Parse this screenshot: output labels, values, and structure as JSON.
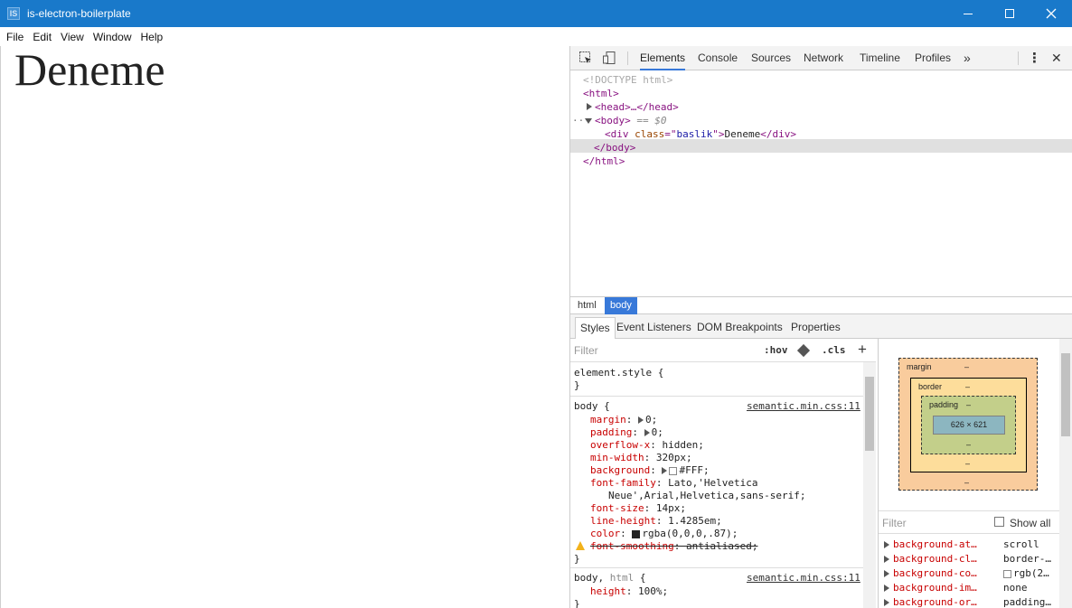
{
  "window": {
    "app_icon_text": "IS",
    "title": "is-electron-boilerplate",
    "minimize_label": "—",
    "close_label": "✕"
  },
  "menu": [
    "File",
    "Edit",
    "View",
    "Window",
    "Help"
  ],
  "page": {
    "heading": "Deneme"
  },
  "devtools": {
    "tabs": [
      "Elements",
      "Console",
      "Sources",
      "Network",
      "Timeline",
      "Profiles"
    ],
    "more_tabs": "»",
    "kebab": "⋮",
    "close": "✕",
    "dom": {
      "doctype": "<!DOCTYPE html>",
      "html_open": "<html>",
      "head": "<head>…</head>",
      "body_open": "<body>",
      "body_marker": " == $0",
      "div_open_tag": "<div",
      "div_attr_name": " class",
      "div_attr_eq": "=\"",
      "div_attr_value": "baslik",
      "div_attr_end": "\">",
      "div_text": "Deneme",
      "div_close": "</div>",
      "body_close": "</body>",
      "html_close": "</html>",
      "ellipsis_marker": "···"
    },
    "breadcrumbs": [
      "html",
      "body"
    ],
    "subtabs": [
      "Styles",
      "Event Listeners",
      "DOM Breakpoints",
      "Properties"
    ],
    "styles": {
      "filter_placeholder": "Filter",
      "hov": ":hov",
      "cls": ".cls",
      "add": "+",
      "element_style": "element.style {",
      "close_brace": "}",
      "rule1_selector": "body {",
      "rule1_source": "semantic.min.css:11",
      "rule1": [
        {
          "prop": "margin",
          "val": "0;"
        },
        {
          "prop": "padding",
          "val": "0;"
        },
        {
          "prop": "overflow-x",
          "val": "hidden;"
        },
        {
          "prop": "min-width",
          "val": "320px;"
        },
        {
          "prop": "background",
          "val": "#FFF;"
        },
        {
          "prop": "font-family",
          "val": "Lato,'Helvetica"
        },
        {
          "prop": "",
          "val": "Neue',Arial,Helvetica,sans-serif;"
        },
        {
          "prop": "font-size",
          "val": "14px;"
        },
        {
          "prop": "line-height",
          "val": "1.4285em;"
        },
        {
          "prop": "color",
          "val": "rgba(0,0,0,.87);"
        },
        {
          "prop": "font-smoothing",
          "val": "antialiased;"
        }
      ],
      "rule2_selector_a": "body, ",
      "rule2_selector_b": "html",
      "rule2_selector_c": " {",
      "rule2_source": "semantic.min.css:11",
      "rule2": [
        {
          "prop": "height",
          "val": "100%;"
        }
      ]
    },
    "box_model": {
      "margin_label": "margin",
      "border_label": "border",
      "padding_label": "padding",
      "dash": "–",
      "content_size": "626 × 621"
    },
    "computed": {
      "filter_placeholder": "Filter",
      "show_all": "Show all",
      "rows": [
        {
          "prop": "background-at…",
          "val": "scroll"
        },
        {
          "prop": "background-cl…",
          "val": "border-…"
        },
        {
          "prop": "background-co…",
          "val": "rgb(2…"
        },
        {
          "prop": "background-im…",
          "val": "none"
        },
        {
          "prop": "background-or…",
          "val": "padding…"
        }
      ]
    }
  }
}
